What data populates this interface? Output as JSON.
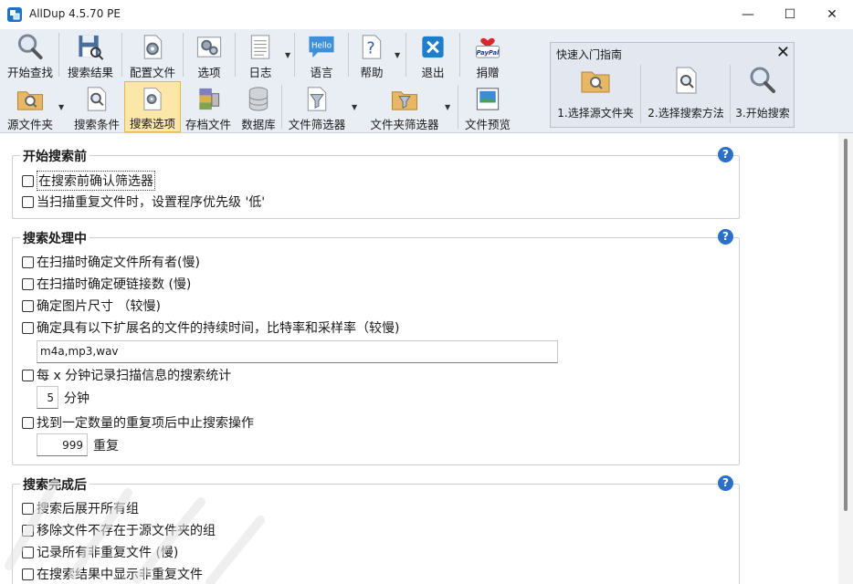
{
  "window": {
    "title": "AllDup 4.5.70 PE",
    "controls": {
      "minimize": "—",
      "maximize": "☐",
      "close": "✕"
    }
  },
  "toolbar": {
    "row1": [
      {
        "label": "开始查找",
        "icon": "magnifier-icon"
      },
      {
        "label": "搜索结果",
        "icon": "floppy-results-icon"
      },
      {
        "label": "配置文件",
        "icon": "config-file-icon"
      },
      {
        "label": "选项",
        "icon": "gears-icon"
      },
      {
        "label": "日志",
        "icon": "log-icon"
      },
      {
        "label": "语言",
        "icon": "hello-bubble-icon",
        "icon_text": "Hello"
      },
      {
        "label": "帮助",
        "icon": "help-document-icon"
      },
      {
        "label": "退出",
        "icon": "exit-x-icon"
      },
      {
        "label": "捐赠",
        "icon": "paypal-heart-icon",
        "icon_text": "PayPal"
      }
    ],
    "row2": [
      {
        "label": "源文件夹",
        "icon": "source-folder-icon"
      },
      {
        "label": "搜索条件",
        "icon": "search-criteria-icon"
      },
      {
        "label": "搜索选项",
        "icon": "search-options-icon",
        "active": true
      },
      {
        "label": "存档文件",
        "icon": "archive-icon"
      },
      {
        "label": "数据库",
        "icon": "database-icon"
      },
      {
        "label": "文件筛选器",
        "icon": "file-filter-icon"
      },
      {
        "label": "文件夹筛选器",
        "icon": "folder-filter-icon"
      },
      {
        "label": "文件预览",
        "icon": "file-preview-icon"
      }
    ]
  },
  "quick_start": {
    "title": "快速入门指南",
    "steps": [
      {
        "label": "1.选择源文件夹",
        "icon": "folder-magnifier-icon"
      },
      {
        "label": "2.选择搜索方法",
        "icon": "document-magnifier-icon"
      },
      {
        "label": "3.开始搜索",
        "icon": "magnifier-icon"
      }
    ]
  },
  "groups": {
    "before": {
      "title": "开始搜索前",
      "options": [
        {
          "label": "在搜索前确认筛选器",
          "checked": false
        },
        {
          "label": "当扫描重复文件时，设置程序优先级 '低'",
          "checked": false
        }
      ]
    },
    "during": {
      "title": "搜索处理中",
      "options": [
        {
          "label": "在扫描时确定文件所有者(慢)",
          "checked": false
        },
        {
          "label": "在扫描时确定硬链接数 (慢)",
          "checked": false
        },
        {
          "label": "确定图片尺寸 （较慢)",
          "checked": false
        },
        {
          "label": "确定具有以下扩展名的文件的持续时间，比特率和采样率（较慢)",
          "checked": false
        },
        {
          "label": "每 x 分钟记录扫描信息的搜索统计",
          "checked": false
        },
        {
          "label": "找到一定数量的重复项后中止搜索操作",
          "checked": false
        }
      ],
      "extensions_value": "m4a,mp3,wav",
      "minutes_value": "5",
      "minutes_unit": "分钟",
      "max_dupes_value": "999",
      "max_dupes_unit": "重复"
    },
    "after": {
      "title": "搜索完成后",
      "options": [
        {
          "label": "搜索后展开所有组",
          "checked": false
        },
        {
          "label": "移除文件不存在于源文件夹的组",
          "checked": false
        },
        {
          "label": "记录所有非重复文件 (慢)",
          "checked": false
        },
        {
          "label": "在搜索结果中显示非重复文件",
          "checked": false
        }
      ]
    },
    "help_glyph": "?"
  },
  "colors": {
    "accent_blue": "#2a6fc9",
    "toolbar_bg": "#e9edf4",
    "active_bg": "#fbe7a8"
  }
}
